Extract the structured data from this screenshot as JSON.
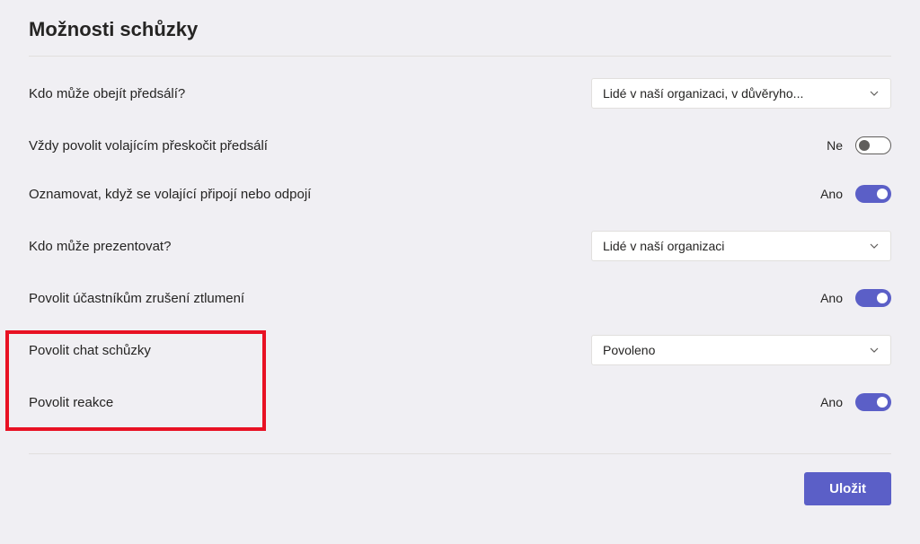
{
  "title": "Možnosti schůzky",
  "options": {
    "bypass_lobby": {
      "label": "Kdo může obejít předsálí?",
      "value": "Lidé v naší organizaci, v důvěryho..."
    },
    "callers_bypass": {
      "label": "Vždy povolit volajícím přeskočit předsálí",
      "state": "Ne",
      "on": false
    },
    "announce_join_leave": {
      "label": "Oznamovat, když se volající připojí nebo odpojí",
      "state": "Ano",
      "on": true
    },
    "who_can_present": {
      "label": "Kdo může prezentovat?",
      "value": "Lidé v naší organizaci"
    },
    "allow_unmute": {
      "label": "Povolit účastníkům zrušení ztlumení",
      "state": "Ano",
      "on": true
    },
    "allow_chat": {
      "label": "Povolit chat schůzky",
      "value": "Povoleno"
    },
    "allow_reactions": {
      "label": "Povolit reakce",
      "state": "Ano",
      "on": true
    }
  },
  "save_label": "Uložit"
}
